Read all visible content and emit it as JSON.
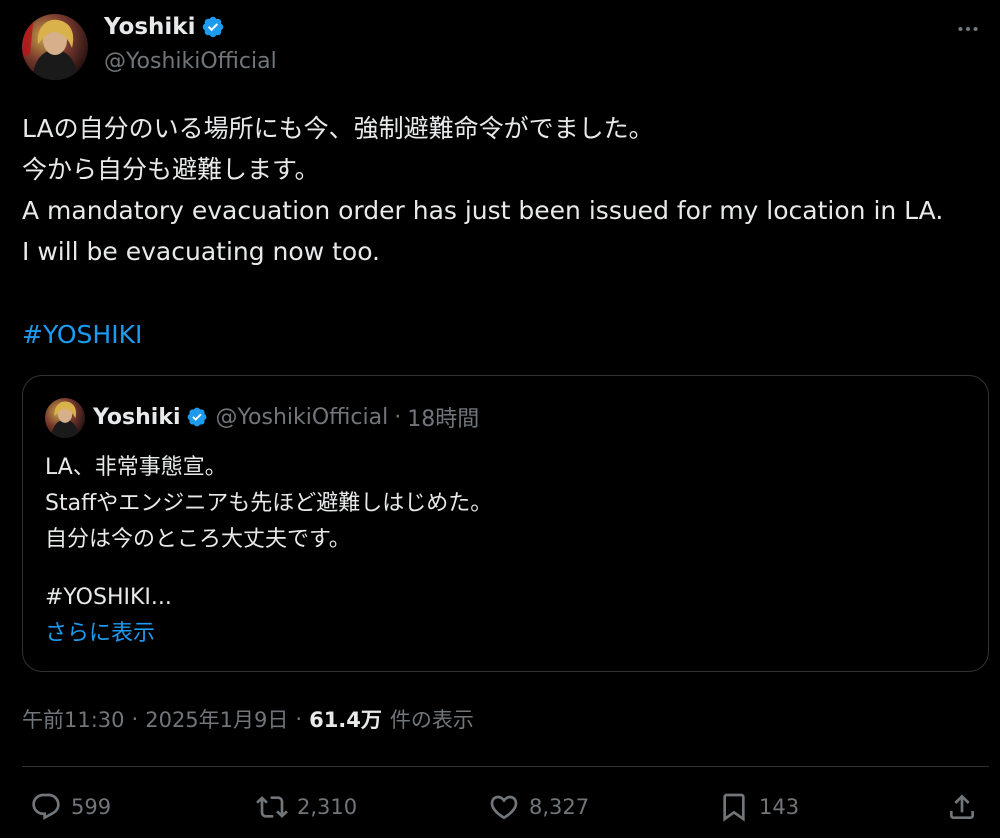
{
  "author": {
    "display_name": "Yoshiki",
    "handle": "@YoshikiOfficial",
    "verified": true
  },
  "post": {
    "lines": [
      "LAの自分のいる場所にも今、強制避難命令がでました。",
      "今から自分も避難します。",
      "A mandatory evacuation order has just been issued for my location in LA.",
      "I will be evacuating now too."
    ],
    "hashtag": "#YOSHIKI"
  },
  "quote": {
    "display_name": "Yoshiki",
    "handle": "@YoshikiOfficial",
    "separator": "·",
    "time": "18時間",
    "lines": [
      "LA、非常事態宣。",
      "Staffやエンジニアも先ほど避難しはじめた。",
      "自分は今のところ大丈夫です。"
    ],
    "hashtag": "#YOSHIKI...",
    "show_more": "さらに表示"
  },
  "meta": {
    "time": "午前11:30",
    "separator": "·",
    "date": "2025年1月9日",
    "views": "61.4万",
    "views_label": "件の表示"
  },
  "actions": {
    "replies": "599",
    "reposts": "2,310",
    "likes": "8,327",
    "bookmarks": "143"
  },
  "icons": {
    "verified": "verified-badge-icon",
    "more": "more-options-icon",
    "reply": "reply-icon",
    "repost": "repost-icon",
    "like": "heart-icon",
    "bookmark": "bookmark-icon",
    "share": "share-icon"
  },
  "colors": {
    "background": "#000000",
    "text": "#e7e9ea",
    "muted": "#71767b",
    "accent": "#1d9bf0",
    "border": "#2f3336"
  }
}
